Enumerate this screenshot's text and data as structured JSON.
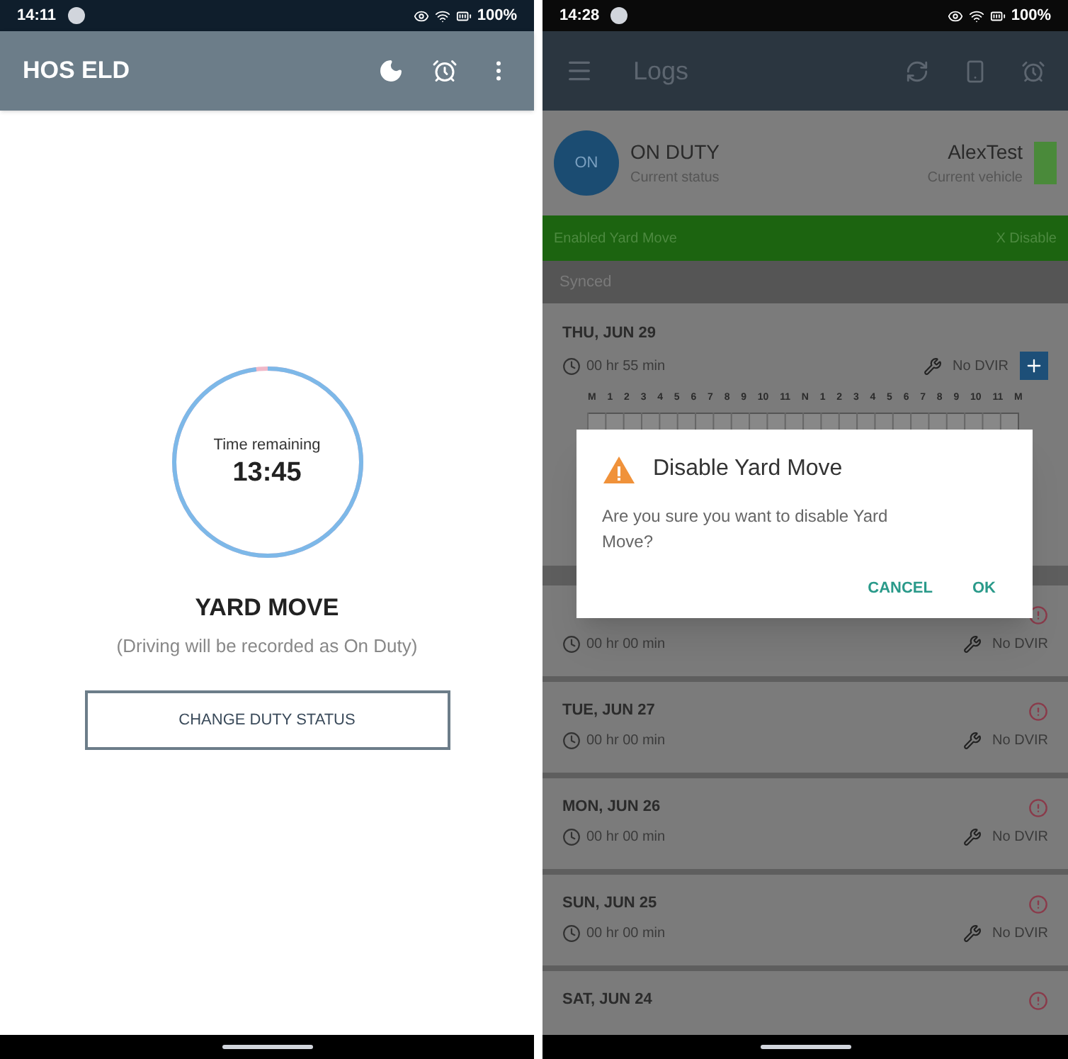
{
  "left": {
    "status_bar": {
      "time": "14:11",
      "battery": "100%"
    },
    "app_bar": {
      "title": "HOS ELD"
    },
    "timer": {
      "label": "Time remaining",
      "value": "13:45",
      "level": 0.98
    },
    "status": {
      "title": "YARD MOVE",
      "subtitle": "(Driving will be recorded as On Duty)"
    },
    "button": "CHANGE DUTY STATUS"
  },
  "right": {
    "status_bar": {
      "time": "14:28",
      "battery": "100%"
    },
    "app_bar": {
      "title": "Logs"
    },
    "current": {
      "avatar": "ON",
      "status": "ON DUTY",
      "status_caption": "Current status",
      "driver": "AlexTest",
      "vehicle_caption": "Current vehicle"
    },
    "banner": {
      "text": "Enabled Yard Move",
      "action": "X Disable"
    },
    "section": "Synced",
    "hours": [
      "M",
      "1",
      "2",
      "3",
      "4",
      "5",
      "6",
      "7",
      "8",
      "9",
      "10",
      "11",
      "N",
      "1",
      "2",
      "3",
      "4",
      "5",
      "6",
      "7",
      "8",
      "9",
      "10",
      "11",
      "M"
    ],
    "days": [
      {
        "date": "THU, JUN 29",
        "duration": "00 hr 55 min",
        "dvir": "No DVIR",
        "kind": "today"
      },
      {
        "duration": "00 hr 00 min",
        "dvir": "No DVIR",
        "kind": "past"
      },
      {
        "date": "TUE, JUN 27",
        "duration": "00 hr 00 min",
        "dvir": "No DVIR",
        "kind": "past"
      },
      {
        "date": "MON, JUN 26",
        "duration": "00 hr 00 min",
        "dvir": "No DVIR",
        "kind": "past"
      },
      {
        "date": "SUN, JUN 25",
        "duration": "00 hr 00 min",
        "dvir": "No DVIR",
        "kind": "past"
      },
      {
        "date": "SAT, JUN 24",
        "kind": "past"
      }
    ],
    "dialog": {
      "title": "Disable Yard Move",
      "message": "Are you sure you want to disable Yard Move?",
      "buttons": [
        "CANCEL",
        "OK"
      ]
    }
  }
}
